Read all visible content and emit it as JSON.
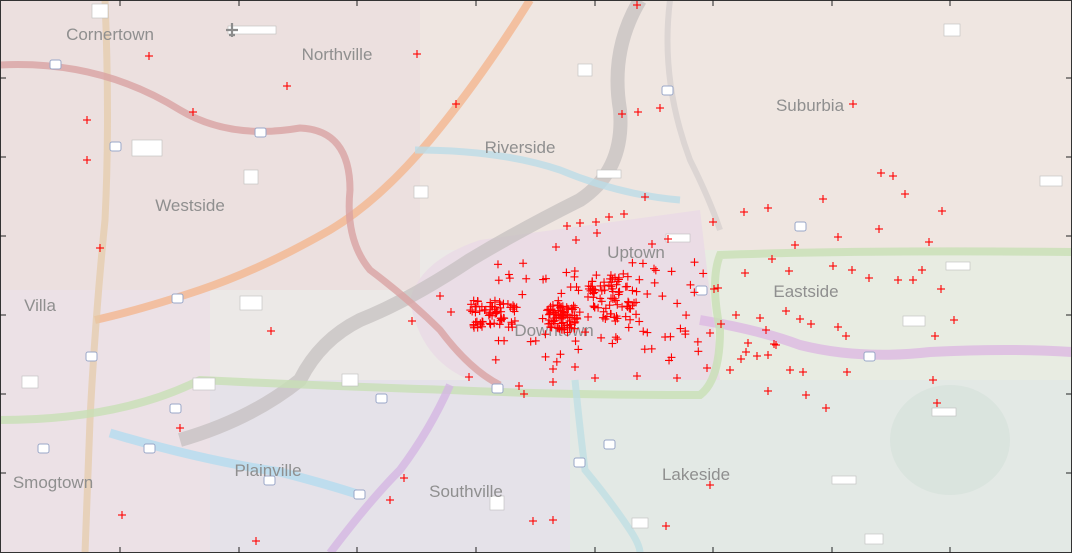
{
  "map": {
    "background": "#ece8e6",
    "marker_color": "#ff0000",
    "region_labels": [
      "Cornertown",
      "Northville",
      "Suburbia",
      "Riverside",
      "Westside",
      "Uptown",
      "Eastside",
      "Villa",
      "Downtown",
      "Plainville",
      "Smogtown",
      "Southville",
      "Lakeside"
    ],
    "icons": [
      "airport-icon",
      "highway-shield-icon",
      "crime-marker-icon"
    ],
    "roads": [
      {
        "name": "orange highway",
        "color": "#f3ae84"
      },
      {
        "name": "red beltway",
        "color": "#d98c8c"
      },
      {
        "name": "green beltway",
        "color": "#b8d9a8"
      },
      {
        "name": "blue highway",
        "color": "#a6d3ea"
      },
      {
        "name": "purple highway",
        "color": "#c9a7d9"
      },
      {
        "name": "river",
        "color": "#9a9a9a"
      }
    ]
  }
}
